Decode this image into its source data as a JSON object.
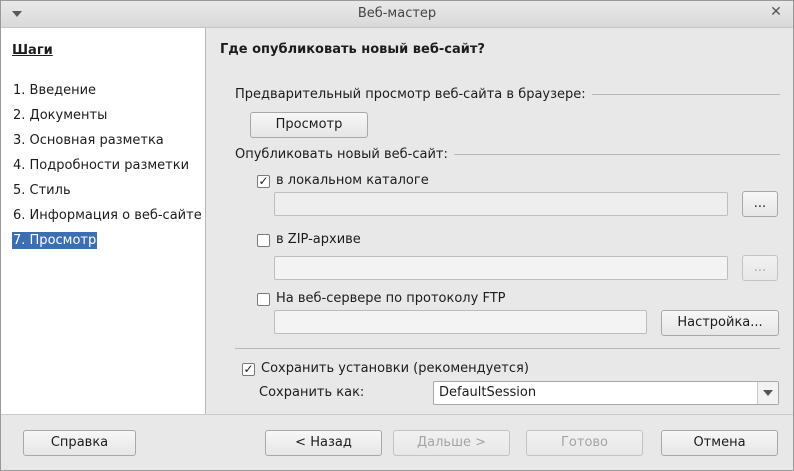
{
  "window": {
    "title": "Веб-мастер",
    "close_glyph": "✕",
    "menu_icon": "chevron-down-icon"
  },
  "sidebar": {
    "heading": "Шаги",
    "steps": [
      {
        "label": "1. Введение"
      },
      {
        "label": "2. Документы"
      },
      {
        "label": "3. Основная разметка"
      },
      {
        "label": "4. Подробности разметки"
      },
      {
        "label": "5. Стиль"
      },
      {
        "label": "6. Информация о веб-сайте"
      },
      {
        "label": "7. Просмотр",
        "active": true
      }
    ]
  },
  "main": {
    "heading": "Где опубликовать новый веб-сайт?",
    "preview_group": {
      "label": "Предварительный просмотр веб-сайта в браузере:",
      "button_label": "Просмотр"
    },
    "publish_group": {
      "label": "Опубликовать новый веб-сайт:",
      "local": {
        "label": "в локальном каталоге",
        "checked": true,
        "path_value": "",
        "browse_label": "...",
        "browse_enabled": true
      },
      "zip": {
        "label": "в ZIP-архиве",
        "checked": false,
        "path_value": "",
        "browse_label": "...",
        "browse_enabled": false
      },
      "ftp": {
        "label": "На веб-сервере по протоколу FTP",
        "checked": false,
        "path_value": "",
        "setup_label": "Настройка..."
      }
    },
    "save_settings": {
      "label": "Сохранить установки (рекомендуется)",
      "checked": true,
      "save_as_label": "Сохранить как:",
      "save_as_value": "DefaultSession"
    }
  },
  "footer": {
    "help_label": "Справка",
    "back_label": "< Назад",
    "next_label": "Дальше >",
    "finish_label": "Готово",
    "cancel_label": "Отмена"
  },
  "colors": {
    "selection": "#3c6eb4",
    "sidebar_bg": "#ffffff",
    "dialog_bg": "#e8e8e8"
  }
}
